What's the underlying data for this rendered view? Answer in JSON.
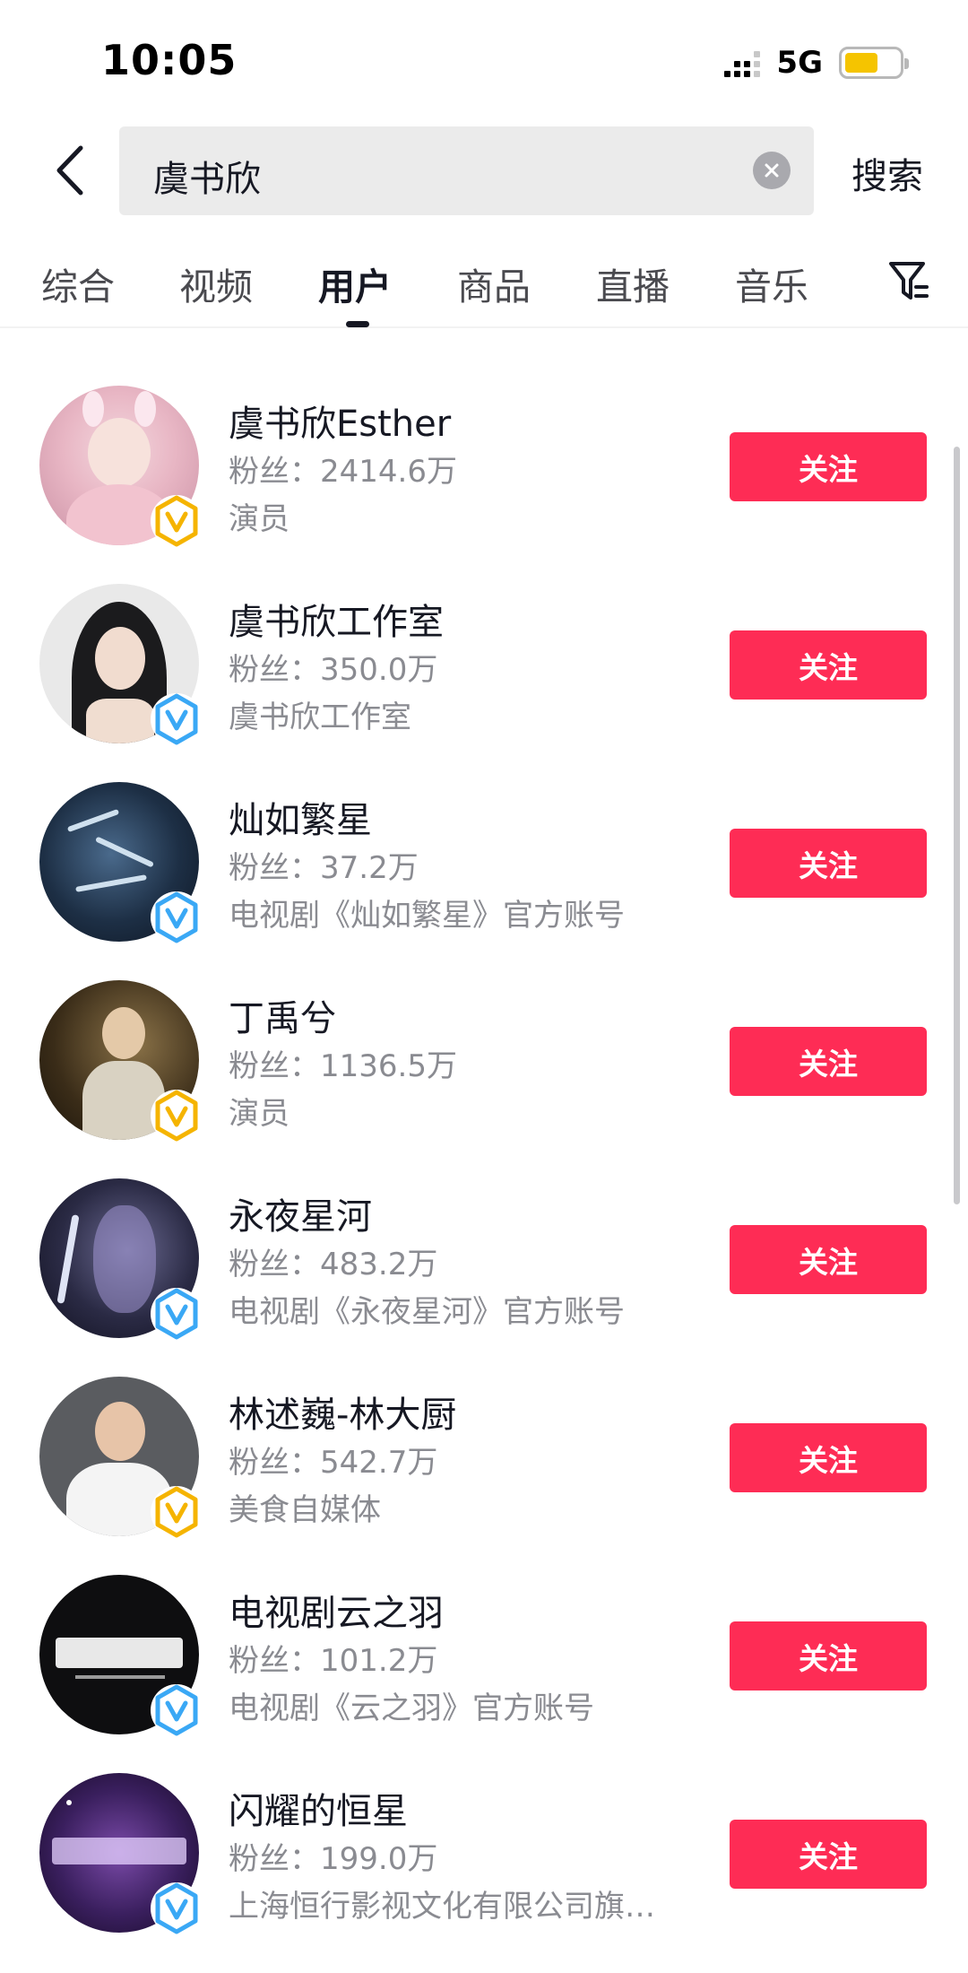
{
  "status_bar": {
    "time": "10:05",
    "network": "5G",
    "battery_level": 0.62,
    "battery_color": "#f5c400"
  },
  "search": {
    "query": "虞书欣",
    "submit_label": "搜索",
    "back_icon": "chevron-left-icon",
    "clear_icon": "clear-circle-icon"
  },
  "tabs": [
    {
      "label": "综合",
      "active": false
    },
    {
      "label": "视频",
      "active": false
    },
    {
      "label": "用户",
      "active": true
    },
    {
      "label": "商品",
      "active": false
    },
    {
      "label": "直播",
      "active": false
    },
    {
      "label": "音乐",
      "active": false
    }
  ],
  "filter_icon": "filter-icon",
  "accent_color": "#fe2c55",
  "users": [
    {
      "name": "虞书欣Esther",
      "fans": "粉丝：2414.6万",
      "desc": "演员",
      "badge": "gold",
      "follow_label": "关注"
    },
    {
      "name": "虞书欣工作室",
      "fans": "粉丝：350.0万",
      "desc": "虞书欣工作室",
      "badge": "blue",
      "follow_label": "关注"
    },
    {
      "name": "灿如繁星",
      "fans": "粉丝：37.2万",
      "desc": "电视剧《灿如繁星》官方账号",
      "badge": "blue",
      "follow_label": "关注"
    },
    {
      "name": "丁禹兮",
      "fans": "粉丝：1136.5万",
      "desc": "演员",
      "badge": "gold",
      "follow_label": "关注"
    },
    {
      "name": "永夜星河",
      "fans": "粉丝：483.2万",
      "desc": "电视剧《永夜星河》官方账号",
      "badge": "blue",
      "follow_label": "关注"
    },
    {
      "name": "林述巍-林大厨",
      "fans": "粉丝：542.7万",
      "desc": "美食自媒体",
      "badge": "gold",
      "follow_label": "关注"
    },
    {
      "name": "电视剧云之羽",
      "fans": "粉丝：101.2万",
      "desc": "电视剧《云之羽》官方账号",
      "badge": "blue",
      "follow_label": "关注"
    },
    {
      "name": "闪耀的恒星",
      "fans": "粉丝：199.0万",
      "desc": "上海恒行影视文化有限公司旗…",
      "badge": "blue",
      "follow_label": "关注"
    }
  ]
}
